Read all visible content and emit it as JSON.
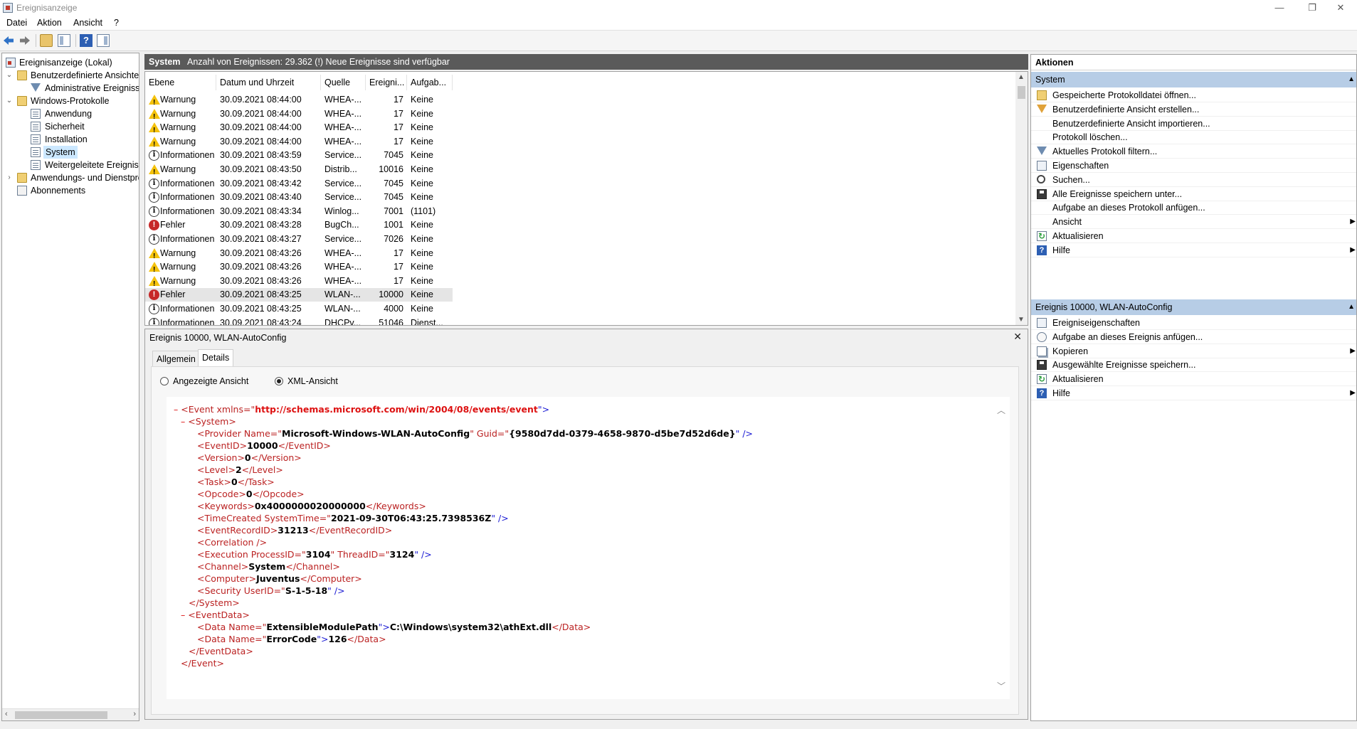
{
  "window": {
    "title": "Ereignisanzeige",
    "minimize": "—",
    "restore": "❐",
    "close": "✕"
  },
  "menu": [
    "Datei",
    "Aktion",
    "Ansicht",
    "?"
  ],
  "toolbar": {
    "back_icon": "arrow-left-icon",
    "forward_icon": "arrow-right-icon",
    "help_label": "?"
  },
  "tree": [
    {
      "label": "Ereignisanzeige (Lokal)",
      "icon": "event-viewer-icon",
      "level": 0,
      "expander": ""
    },
    {
      "label": "Benutzerdefinierte Ansichten",
      "icon": "folder-icon",
      "level": 0,
      "expander": "⌄"
    },
    {
      "label": "Administrative Ereignisse",
      "icon": "filter-icon",
      "level": 1,
      "expander": ""
    },
    {
      "label": "Windows-Protokolle",
      "icon": "folder-icon",
      "level": 0,
      "expander": "⌄"
    },
    {
      "label": "Anwendung",
      "icon": "log-icon",
      "level": 1,
      "expander": ""
    },
    {
      "label": "Sicherheit",
      "icon": "log-icon",
      "level": 1,
      "expander": ""
    },
    {
      "label": "Installation",
      "icon": "log-icon",
      "level": 1,
      "expander": ""
    },
    {
      "label": "System",
      "icon": "log-icon",
      "level": 1,
      "expander": "",
      "selected": true
    },
    {
      "label": "Weitergeleitete Ereignisse",
      "icon": "log-icon",
      "level": 1,
      "expander": ""
    },
    {
      "label": "Anwendungs- und Dienstprotokolle",
      "icon": "folder-icon",
      "level": 0,
      "expander": "›"
    },
    {
      "label": "Abonnements",
      "icon": "subscription-icon",
      "level": 0,
      "expander": ""
    }
  ],
  "center": {
    "header_name": "System",
    "header_count": "Anzahl von Ereignissen: 29.362 (!) Neue Ereignisse sind verfügbar",
    "columns": [
      "Ebene",
      "Datum und Uhrzeit",
      "Quelle",
      "Ereigni...",
      "Aufgab..."
    ],
    "rows": [
      {
        "level": "Warnung",
        "type": "warn",
        "date": "30.09.2021 08:44:00",
        "source": "WHEA-...",
        "id": "17",
        "task": "Keine"
      },
      {
        "level": "Warnung",
        "type": "warn",
        "date": "30.09.2021 08:44:00",
        "source": "WHEA-...",
        "id": "17",
        "task": "Keine"
      },
      {
        "level": "Warnung",
        "type": "warn",
        "date": "30.09.2021 08:44:00",
        "source": "WHEA-...",
        "id": "17",
        "task": "Keine"
      },
      {
        "level": "Warnung",
        "type": "warn",
        "date": "30.09.2021 08:44:00",
        "source": "WHEA-...",
        "id": "17",
        "task": "Keine"
      },
      {
        "level": "Informationen",
        "type": "info",
        "date": "30.09.2021 08:43:59",
        "source": "Service...",
        "id": "7045",
        "task": "Keine"
      },
      {
        "level": "Warnung",
        "type": "warn",
        "date": "30.09.2021 08:43:50",
        "source": "Distrib...",
        "id": "10016",
        "task": "Keine"
      },
      {
        "level": "Informationen",
        "type": "info",
        "date": "30.09.2021 08:43:42",
        "source": "Service...",
        "id": "7045",
        "task": "Keine"
      },
      {
        "level": "Informationen",
        "type": "info",
        "date": "30.09.2021 08:43:40",
        "source": "Service...",
        "id": "7045",
        "task": "Keine"
      },
      {
        "level": "Informationen",
        "type": "info",
        "date": "30.09.2021 08:43:34",
        "source": "Winlog...",
        "id": "7001",
        "task": "(1101)"
      },
      {
        "level": "Fehler",
        "type": "err",
        "date": "30.09.2021 08:43:28",
        "source": "BugCh...",
        "id": "1001",
        "task": "Keine"
      },
      {
        "level": "Informationen",
        "type": "info",
        "date": "30.09.2021 08:43:27",
        "source": "Service...",
        "id": "7026",
        "task": "Keine"
      },
      {
        "level": "Warnung",
        "type": "warn",
        "date": "30.09.2021 08:43:26",
        "source": "WHEA-...",
        "id": "17",
        "task": "Keine"
      },
      {
        "level": "Warnung",
        "type": "warn",
        "date": "30.09.2021 08:43:26",
        "source": "WHEA-...",
        "id": "17",
        "task": "Keine"
      },
      {
        "level": "Warnung",
        "type": "warn",
        "date": "30.09.2021 08:43:26",
        "source": "WHEA-...",
        "id": "17",
        "task": "Keine"
      },
      {
        "level": "Fehler",
        "type": "err",
        "date": "30.09.2021 08:43:25",
        "source": "WLAN-...",
        "id": "10000",
        "task": "Keine",
        "selected": true
      },
      {
        "level": "Informationen",
        "type": "info",
        "date": "30.09.2021 08:43:25",
        "source": "WLAN-...",
        "id": "4000",
        "task": "Keine"
      },
      {
        "level": "Informationen",
        "type": "info",
        "date": "30.09.2021 08:43:24",
        "source": "DHCPv...",
        "id": "51046",
        "task": "Dienst..."
      }
    ]
  },
  "detail": {
    "title": "Ereignis 10000, WLAN-AutoConfig",
    "close": "✕",
    "tabs": [
      "Allgemein",
      "Details"
    ],
    "active_tab": "Details",
    "radio_friendly": "Angezeigte Ansicht",
    "radio_xml": "XML-Ansicht",
    "xml": {
      "minus": "–",
      "event_open": "<Event xmlns=\"",
      "namespace": "http://schemas.microsoft.com/win/2004/08/events/event",
      "event_open_end": "\">",
      "system_open": "<System>",
      "provider_open": "<Provider Name=\"",
      "provider_name": "Microsoft-Windows-WLAN-AutoConfig",
      "provider_guid_attr": "\" Guid=\"",
      "provider_guid": "{9580d7dd-0379-4658-9870-d5be7d52d6de}",
      "provider_close": "\" />",
      "event_id_open": "<EventID>",
      "event_id": "10000",
      "event_id_close": "</EventID>",
      "version_open": "<Version>",
      "version": "0",
      "version_close": "</Version>",
      "level_open": "<Level>",
      "level": "2",
      "level_close": "</Level>",
      "task_open": "<Task>",
      "task": "0",
      "task_close": "</Task>",
      "opcode_open": "<Opcode>",
      "opcode": "0",
      "opcode_close": "</Opcode>",
      "keywords_open": "<Keywords>",
      "keywords": "0x4000000020000000",
      "keywords_close": "</Keywords>",
      "timecreated_open": "<TimeCreated SystemTime=\"",
      "timecreated": "2021-09-30T06:43:25.7398536Z",
      "timecreated_close": "\" />",
      "record_open": "<EventRecordID>",
      "record": "31213",
      "record_close": "</EventRecordID>",
      "correlation": "<Correlation />",
      "exec_open": "<Execution ProcessID=\"",
      "process_id": "3104",
      "exec_mid": "\" ThreadID=\"",
      "thread_id": "3124",
      "exec_close": "\" />",
      "channel_open": "<Channel>",
      "channel": "System",
      "channel_close": "</Channel>",
      "computer_open": "<Computer>",
      "computer": "Juventus",
      "computer_close": "</Computer>",
      "security_open": "<Security UserID=\"",
      "user_id": "S-1-5-18",
      "security_close": "\" />",
      "system_close": "</System>",
      "eventdata_open": "<EventData>",
      "data1_open": "<Data Name=\"",
      "data1_name": "ExtensibleModulePath",
      "data1_mid": "\">",
      "data1_value": "C:\\Windows\\system32\\athExt.dll",
      "data1_close": "</Data>",
      "data2_open": "<Data Name=\"",
      "data2_name": "ErrorCode",
      "data2_mid": "\">",
      "data2_value": "126",
      "data2_close": "</Data>",
      "eventdata_close": "</EventData>",
      "event_close": "</Event>"
    }
  },
  "actions": {
    "title": "Aktionen",
    "section1": "System",
    "items1": [
      {
        "label": "Gespeicherte Protokolldatei öffnen...",
        "icon": "open-folder-icon"
      },
      {
        "label": "Benutzerdefinierte Ansicht erstellen...",
        "icon": "create-filter-icon"
      },
      {
        "label": "Benutzerdefinierte Ansicht importieren...",
        "icon": ""
      },
      {
        "label": "Protokoll löschen...",
        "icon": ""
      },
      {
        "label": "Aktuelles Protokoll filtern...",
        "icon": "filter-icon"
      },
      {
        "label": "Eigenschaften",
        "icon": "properties-icon"
      },
      {
        "label": "Suchen...",
        "icon": "binoculars-icon"
      },
      {
        "label": "Alle Ereignisse speichern unter...",
        "icon": "save-icon"
      },
      {
        "label": "Aufgabe an dieses Protokoll anfügen...",
        "icon": ""
      },
      {
        "label": "Ansicht",
        "icon": "",
        "submenu": true
      },
      {
        "label": "Aktualisieren",
        "icon": "refresh-icon"
      },
      {
        "label": "Hilfe",
        "icon": "help-icon",
        "submenu": true
      }
    ],
    "section2": "Ereignis 10000, WLAN-AutoConfig",
    "items2": [
      {
        "label": "Ereigniseigenschaften",
        "icon": "properties-icon"
      },
      {
        "label": "Aufgabe an dieses Ereignis anfügen...",
        "icon": "task-icon"
      },
      {
        "label": "Kopieren",
        "icon": "copy-icon",
        "submenu": true
      },
      {
        "label": "Ausgewählte Ereignisse speichern...",
        "icon": "save-icon"
      },
      {
        "label": "Aktualisieren",
        "icon": "refresh-icon"
      },
      {
        "label": "Hilfe",
        "icon": "help-icon",
        "submenu": true
      }
    ]
  }
}
